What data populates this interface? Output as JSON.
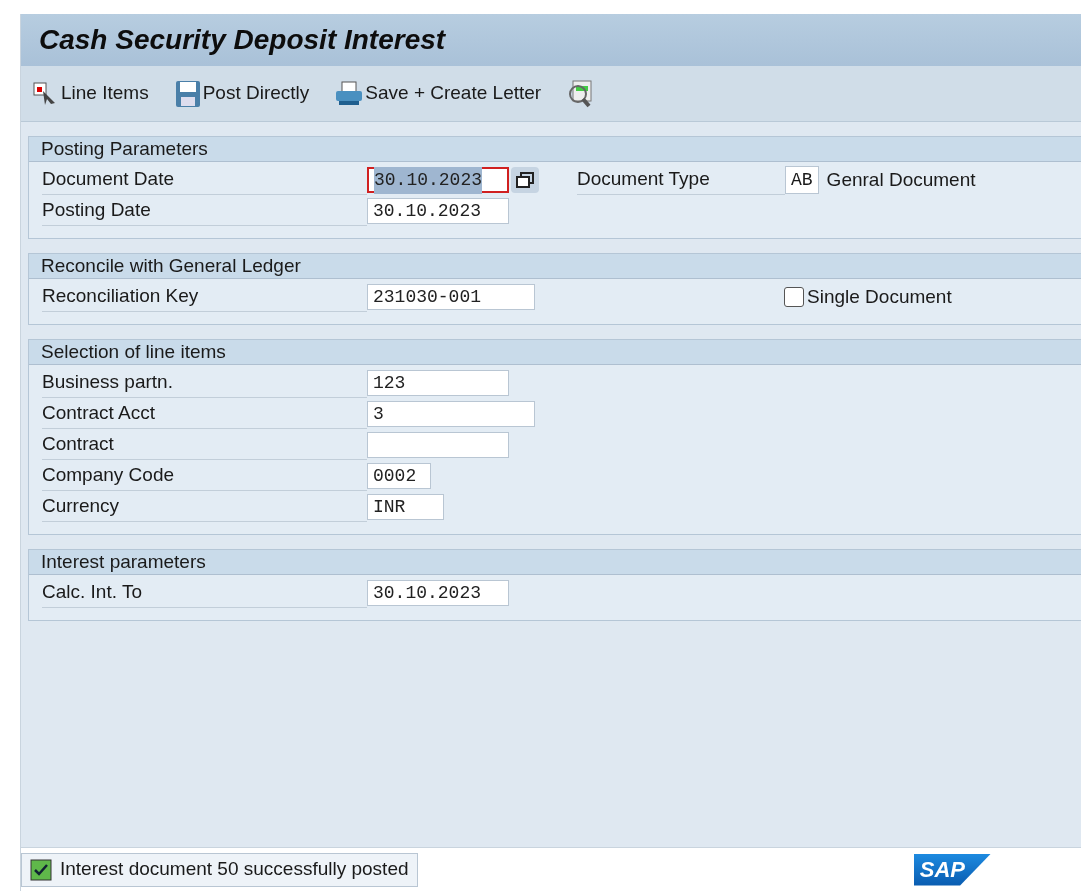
{
  "window": {
    "title": "Cash Security Deposit Interest"
  },
  "toolbar": [
    {
      "kind": "line-items",
      "label": "Line Items"
    },
    {
      "kind": "save",
      "label": "Post Directly"
    },
    {
      "kind": "print",
      "label": "Save + Create Letter"
    },
    {
      "kind": "find"
    }
  ],
  "groups": [
    {
      "title": "Posting Parameters",
      "rows": [
        {
          "label": "Document Date",
          "value": "30.10.2023",
          "kind": "date",
          "focused": true,
          "has_f4": true,
          "side": {
            "kind": "field",
            "label": "Document Type",
            "value": "AB",
            "text": "Genral Document"
          }
        },
        {
          "label": "Posting Date",
          "value": "30.10.2023",
          "kind": "date",
          "focused": false,
          "has_f4": false
        }
      ]
    },
    {
      "title": "Reconcile with General Ledger",
      "rows": [
        {
          "label": "Reconciliation Key",
          "value": "231030-001",
          "kind": "wide",
          "focused": false,
          "has_f4": false,
          "side": {
            "kind": "checkbox",
            "label": "Single Document",
            "checked": false
          }
        }
      ]
    },
    {
      "title": "Selection of line items",
      "rows": [
        {
          "label": "Business partn.",
          "value": "123",
          "kind": "date",
          "focused": false,
          "has_f4": false
        },
        {
          "label": "Contract Acct",
          "value": "3",
          "kind": "wide",
          "focused": false,
          "has_f4": false
        },
        {
          "label": "Contract",
          "value": "",
          "kind": "date",
          "focused": false,
          "has_f4": false
        },
        {
          "label": "Company Code",
          "value": "0002",
          "kind": "code",
          "focused": false,
          "has_f4": false
        },
        {
          "label": "Currency",
          "value": "INR",
          "kind": "curr",
          "focused": false,
          "has_f4": false
        }
      ]
    },
    {
      "title": "Interest parameters",
      "rows": [
        {
          "label": "Calc. Int. To",
          "value": "30.10.2023",
          "kind": "date",
          "focused": false,
          "has_f4": false
        }
      ]
    }
  ],
  "status_bar": {
    "kind": "success",
    "message": "Interest document 50 successfully posted",
    "logo": "SAP"
  }
}
